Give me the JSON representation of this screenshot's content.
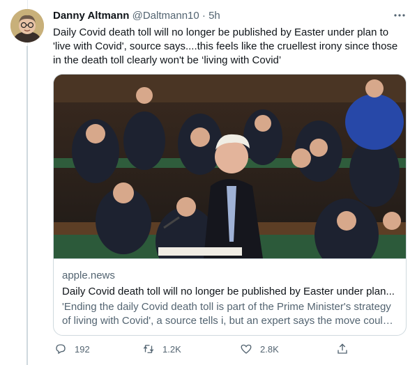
{
  "tweet": {
    "author_name": "Danny Altmann",
    "author_handle": "@Daltmann10",
    "separator": "·",
    "time": "5h",
    "text": "Daily Covid death toll will no longer be published by Easter under plan to 'live with Covid', source says....this feels like the cruellest irony since those in the death toll clearly won't be ‘living with Covid’",
    "card": {
      "domain": "apple.news",
      "title": "Daily Covid death toll will no longer be published by Easter under plan...",
      "description_line1": "'Ending the daily Covid death toll is part of the Prime Minister's strategy",
      "description_line2": "of living with Covid', a source tells i, but an expert says the move could ..."
    },
    "actions": {
      "reply_count": "192",
      "retweet_count": "1.2K",
      "like_count": "2.8K"
    }
  },
  "colors": {
    "text_primary": "#0f1419",
    "text_secondary": "#536471",
    "border": "#cfd9de"
  },
  "icons": {
    "more": "more-horizontal-icon",
    "reply": "reply-icon",
    "retweet": "retweet-icon",
    "like": "heart-icon",
    "share": "share-icon"
  }
}
